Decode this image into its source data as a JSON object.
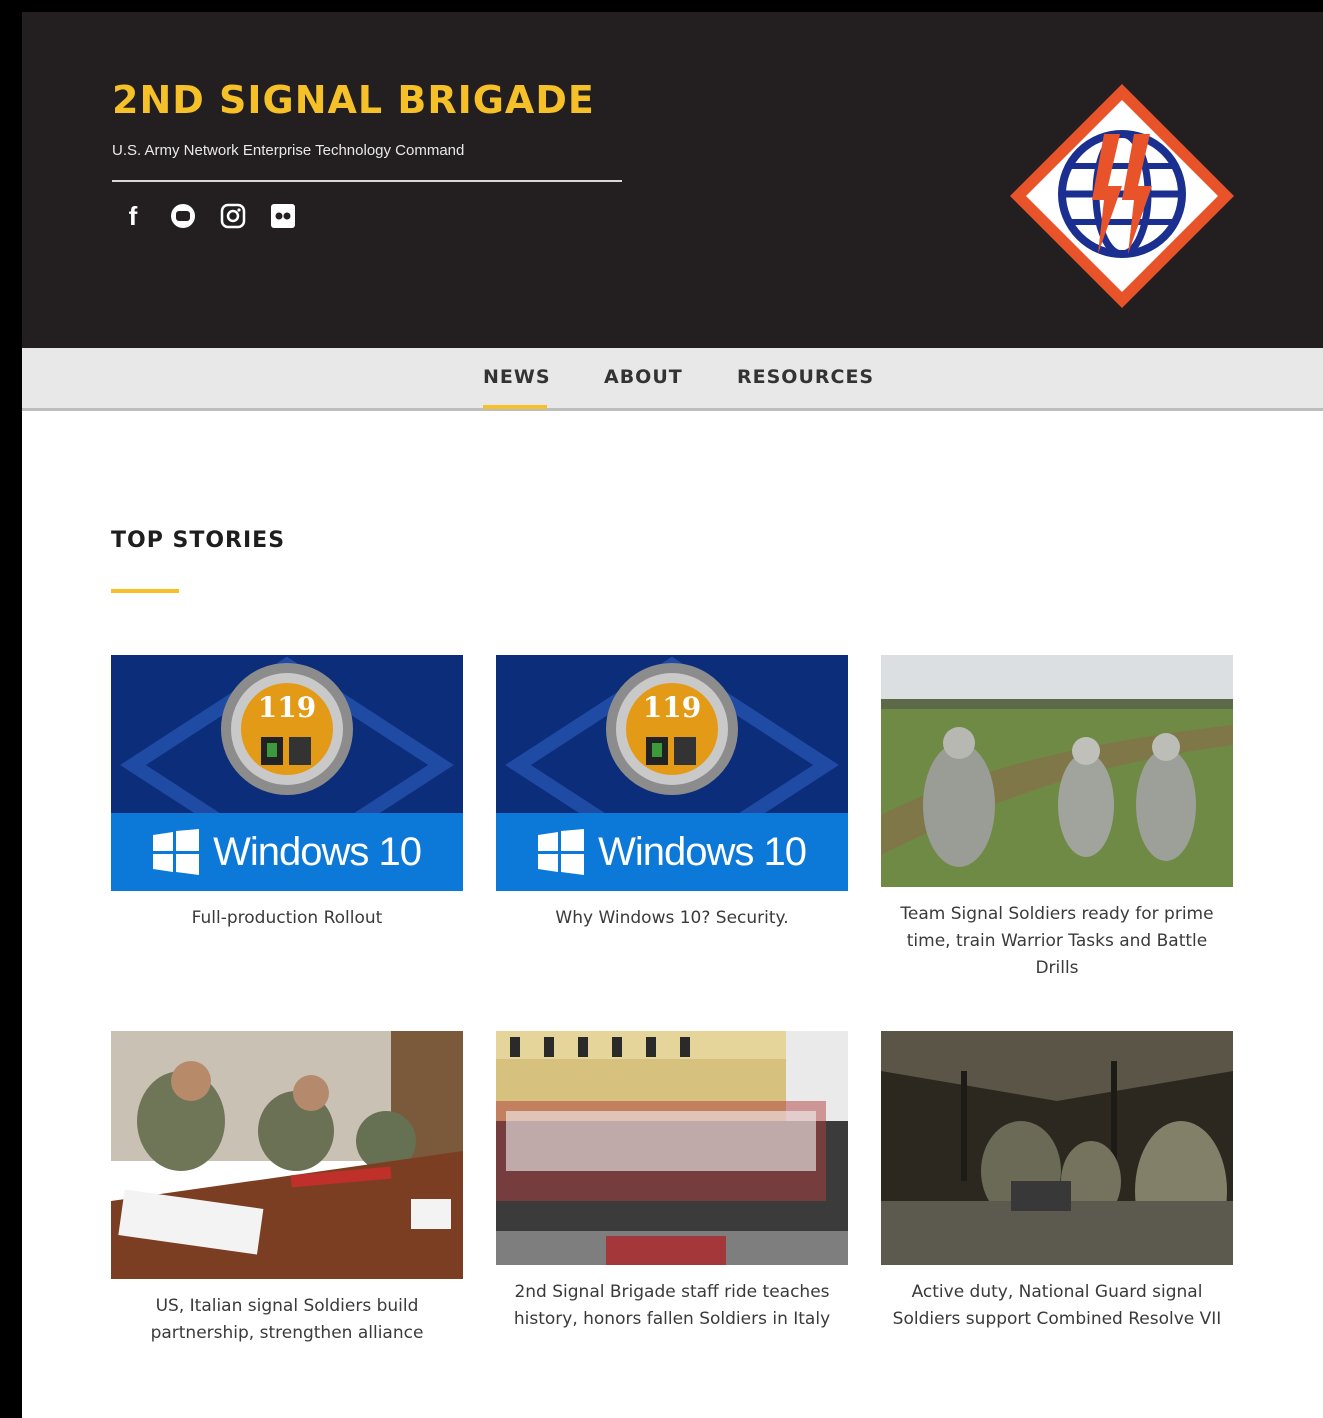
{
  "site": {
    "title": "2ND SIGNAL BRIGADE",
    "subtitle": "U.S. Army Network Enterprise Technology Command",
    "social": [
      {
        "icon": "facebook-icon",
        "glyph": "f"
      },
      {
        "icon": "youtube-icon"
      },
      {
        "icon": "instagram-icon"
      },
      {
        "icon": "flickr-icon"
      }
    ],
    "emblem": "brigade-emblem"
  },
  "nav": {
    "items": [
      {
        "label": "NEWS",
        "active": true
      },
      {
        "label": "ABOUT",
        "active": false
      },
      {
        "label": "RESOURCES",
        "active": false
      }
    ]
  },
  "main": {
    "section_title": "TOP STORIES",
    "stories": [
      {
        "caption": "Full-production Rollout",
        "badge_text": "119",
        "product_label": "Windows 10"
      },
      {
        "caption": "Why Windows 10? Security.",
        "badge_text": "119",
        "product_label": "Windows 10"
      },
      {
        "caption": "Team Signal Soldiers ready for prime time, train Warrior Tasks and Battle Drills"
      },
      {
        "caption": "US, Italian signal Soldiers build partnership, strengthen alliance"
      },
      {
        "caption": "2nd Signal Brigade staff ride teaches history, honors fallen Soldiers in Italy"
      },
      {
        "caption": "Active duty, National Guard signal Soldiers support Combined Resolve VII"
      }
    ]
  },
  "colors": {
    "header_bg": "#231f20",
    "accent": "#f5c028",
    "nav_bg": "#e8e8e8",
    "windows_blue": "#0c78d8"
  }
}
